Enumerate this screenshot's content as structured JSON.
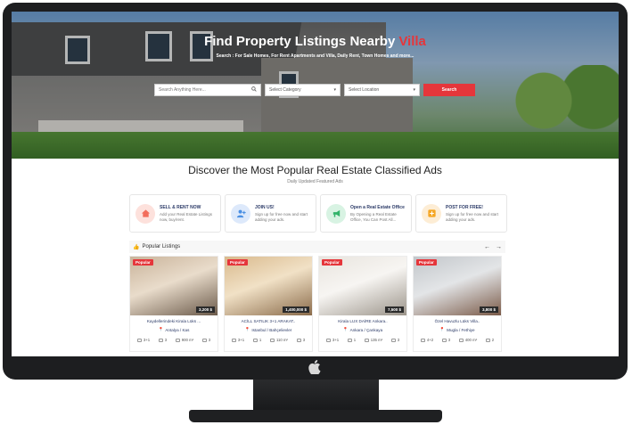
{
  "hero": {
    "title": "Find Property Listings Nearby",
    "title_accent": "Villa",
    "subtitle": "Search : For Sale Homes, For Rent Apartments and Villa, Daily Rent, Town Homes and more...",
    "search": {
      "placeholder": "Search Anything Here...",
      "category_value": "Select Category",
      "location_value": "Select Location",
      "button_label": "Search"
    }
  },
  "section": {
    "title": "Discover the Most Popular Real Estate Classified Ads",
    "subtitle": "Daily Updated Featured Ads"
  },
  "features": [
    {
      "title": "SELL & RENT NOW",
      "desc": "Add your Real Estate Listings now, buy/rent.",
      "icon": "home-icon",
      "color": "#f26d5b",
      "bg": "#fde1dc"
    },
    {
      "title": "JOIN US!",
      "desc": "Sign up for free now and start adding your ads.",
      "icon": "user-plus-icon",
      "color": "#4b8fe3",
      "bg": "#dde9fb"
    },
    {
      "title": "Open a Real Estate Office",
      "desc": "By Opening a Real Estate Office, You Can Post All...",
      "icon": "megaphone-icon",
      "color": "#32b36a",
      "bg": "#d8f3e3"
    },
    {
      "title": "POST FOR FREE!",
      "desc": "Sign up for free now and start adding your ads.",
      "icon": "plus-square-icon",
      "color": "#f5a623",
      "bg": "#fdedd5"
    }
  ],
  "popular": {
    "title": "Popular Listings",
    "listings": [
      {
        "badge": "Popular",
        "price": "3,200 $",
        "title": "Kaydellerindeki Kirala Lüks ...",
        "location": "Antalya / Kas",
        "rooms": "3+1",
        "baths": "3",
        "area": "900 m²",
        "floor": "3",
        "img_a": "#c9b39a",
        "img_b": "#6b5a4a"
      },
      {
        "badge": "Popular",
        "price": "1,400,000 $",
        "title": "ACİLL SATILIK 3+1 ARAKAT..",
        "location": "Istanbul / Bahçelievler",
        "rooms": "3+1",
        "baths": "1",
        "area": "110 m²",
        "floor": "3",
        "img_a": "#d9b98c",
        "img_b": "#8a6b4a"
      },
      {
        "badge": "Popular",
        "price": "7,500 $",
        "title": "Kirala LUX DAİRE Ankara..",
        "location": "Ankara / Çankaya",
        "rooms": "3+1",
        "baths": "1",
        "area": "135 m²",
        "floor": "3",
        "img_a": "#e8e4de",
        "img_b": "#9b948a"
      },
      {
        "badge": "Popular",
        "price": "3,800 $",
        "title": "Özel Havuzlu Lüks Villa..",
        "location": "Mugla / Fethiye",
        "rooms": "4+2",
        "baths": "3",
        "area": "400 m²",
        "floor": "2",
        "img_a": "#c2c6ca",
        "img_b": "#7a5a48"
      }
    ]
  }
}
